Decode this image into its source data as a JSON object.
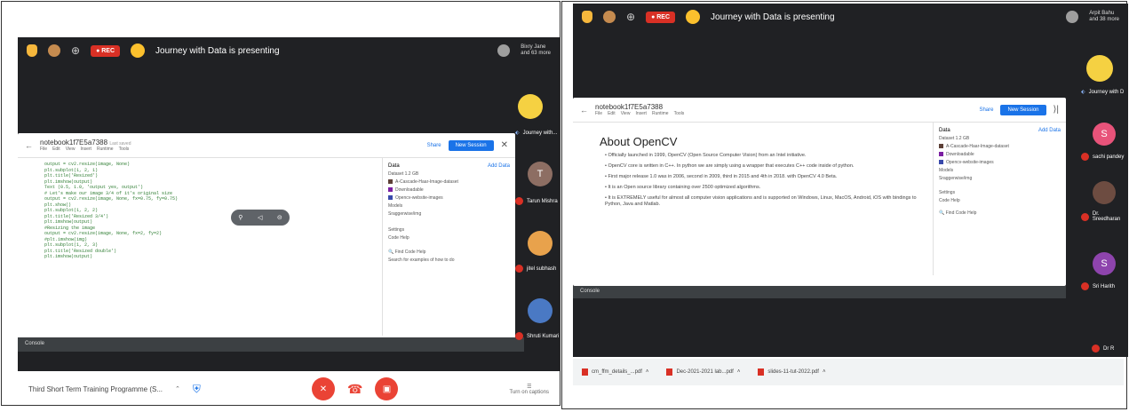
{
  "left": {
    "rec": "● REC",
    "presenting": "Journey with Data is presenting",
    "host_line1": "Bixry Jane",
    "host_line2": "and 63 more",
    "colab": {
      "title": "notebook1f7E5a7388",
      "saved": "Last saved",
      "menu": [
        "File",
        "Edit",
        "View",
        "Insert",
        "Runtime",
        "Tools"
      ],
      "share": "Share",
      "new_session": "New Session",
      "code_lines": [
        "output = cv2.resize(image, None)",
        "plt.subplot(1, 2, 1)",
        "plt.title('Resized')",
        "plt.imshow(output)",
        "Text (0.5, 1.0, 'output yes, output')",
        "# Let's make our image 3/4 of it's original size",
        "output = cv2.resize(image, None, fx=0.75, fy=0.75)",
        "plt.show()",
        "plt.subplot(1, 2, 2)",
        "plt.title('Resized 3/4')",
        "plt.imshow(output)",
        "#Resizing the image",
        "output = cv2.resize(image, None, fx=2, fy=2)",
        "#plt.imshow(img)",
        "plt.subplot(1, 2, 3)",
        "plt.title('Resized double')",
        "plt.imshow(output)"
      ],
      "panel_title": "Data",
      "panel_add": "Add Data",
      "panel_items": [
        "Dataset 1.2 GB",
        "A-Cascade-Haar-Image-dataset",
        "Downloadable",
        "Opencv-website-images",
        "Models",
        "Sraggerwise/img"
      ],
      "panel_settings": "Settings",
      "panel_code_help": "Code Help",
      "find_code_help": "Find Code Help",
      "search_hint": "Search for examples of how to do",
      "console": "Console"
    },
    "participants": [
      {
        "name": "Journey with...",
        "color": "#f5d142",
        "letter": ""
      },
      {
        "name": "Tarun Mishra",
        "color": "#8d6e63",
        "letter": "T"
      },
      {
        "name": "jitel subhash",
        "color": "#e8a24c",
        "letter": ""
      },
      {
        "name": "Shruti Kumari",
        "color": "#4a79c4",
        "letter": ""
      }
    ],
    "meeting_name": "Third Short Term Training Programme (S...",
    "caption": "Turn on captions"
  },
  "right": {
    "rec": "● REC",
    "presenting": "Journey with Data is presenting",
    "host_line1": "Arpit Bahu",
    "host_line2": "and 38 more",
    "colab": {
      "title": "notebook1f7E5a7388",
      "menu": [
        "File",
        "Edit",
        "View",
        "Insert",
        "Runtime",
        "Tools"
      ],
      "share": "Share",
      "new_session": "New Session",
      "heading": "About OpenCV",
      "bullets": [
        "Officially launched in 1999, OpenCV (Open Source Computer Vision) from an Intel initiative.",
        "OpenCV core is written in C++. In python we are simply using a wrapper that executes C++ code inside of python.",
        "First major release 1.0 was in 2006, second in 2009, third in 2015 and 4th in 2018. with OpenCV 4.0 Beta.",
        "It is an Open source library containing over 2500 optimized algorithms.",
        "It is EXTREMELY useful for almost all computer vision applications and is supported on Windows, Linux, MacOS, Android, iOS with bindings to Python, Java and Matlab."
      ],
      "panel_title": "Data",
      "panel_add": "Add Data",
      "panel_items": [
        "Dataset 1.2 GB",
        "A-Cascade-Haar-Image-dataset",
        "Downloadable",
        "Opencv-website-images",
        "Models",
        "Sraggerwise/img"
      ],
      "panel_settings": "Settings",
      "panel_code_help": "Code Help",
      "find_code_help": "Find Code Help",
      "console": "Console"
    },
    "participants": [
      {
        "name": "Journey with D",
        "color": "#f5d142",
        "letter": ""
      },
      {
        "name": "sachi pandey",
        "color": "#e8537a",
        "letter": "S"
      },
      {
        "name": "Dr. Sreedharan",
        "color": "#6d4c41",
        "letter": ""
      },
      {
        "name": "Sri Harith",
        "color": "#8e44ad",
        "letter": "S"
      },
      {
        "name": "Dr R",
        "color": "#d93025",
        "letter": ""
      }
    ],
    "downloads": [
      "cm_ffm_details_...pdf",
      "Dec-2021-2021 lab...pdf",
      "slides-11-tut-2022.pdf"
    ]
  }
}
